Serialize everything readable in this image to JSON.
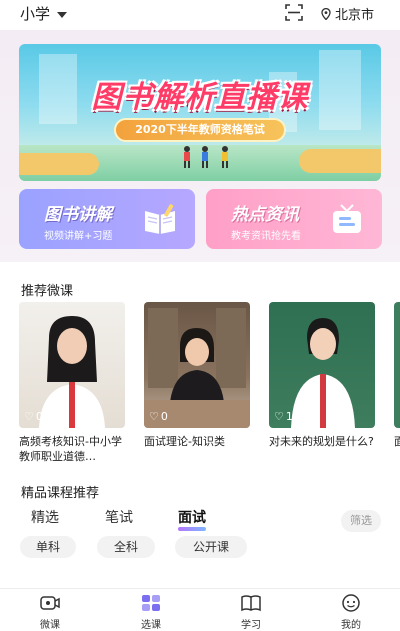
{
  "header": {
    "grade": "小学",
    "city": "北京市"
  },
  "banner": {
    "title": "图书解析直播课",
    "subtitle": "2020下半年教师资格笔试"
  },
  "features": [
    {
      "title": "图书讲解",
      "subtitle": "视频讲解+习题"
    },
    {
      "title": "热点资讯",
      "subtitle": "教考资讯抢先看"
    }
  ],
  "micro_section": {
    "title": "推荐微课",
    "videos": [
      {
        "likes": "0",
        "title": "高频考核知识-中小学教师职业道德…"
      },
      {
        "likes": "0",
        "title": "面试理论-知识类"
      },
      {
        "likes": "1",
        "title": "对未来的规划是什么?"
      },
      {
        "likes": "",
        "title": "面"
      }
    ]
  },
  "courses_section": {
    "title": "精品课程推荐",
    "tabs": [
      "精选",
      "笔试",
      "面试"
    ],
    "active_tab": "面试",
    "filter_label": "筛选",
    "chips": [
      "单科",
      "全科",
      "公开课"
    ]
  },
  "bottom_nav": [
    {
      "label": "微课",
      "icon": "video-camera-icon"
    },
    {
      "label": "选课",
      "icon": "course-select-icon",
      "active": true
    },
    {
      "label": "学习",
      "icon": "book-icon"
    },
    {
      "label": "我的",
      "icon": "profile-face-icon"
    }
  ],
  "colors": {
    "accent_purple": "#9aa2ff",
    "accent_pink": "#ff9fc7",
    "banner_title": "#ff3b67",
    "tab_underline": "#b476ff"
  }
}
